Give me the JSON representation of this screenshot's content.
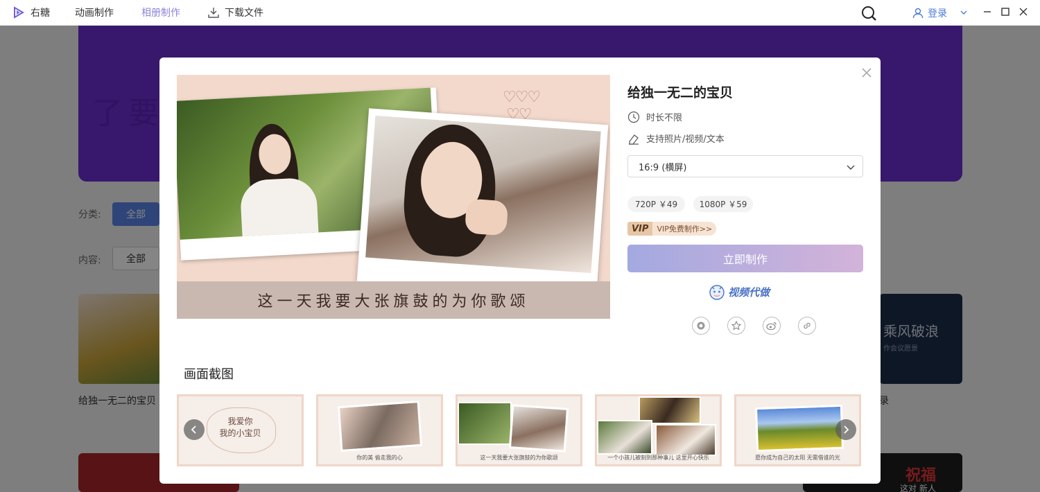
{
  "app": {
    "name": "右糖"
  },
  "nav": {
    "animation": "动画制作",
    "album": "相册制作",
    "download": "下载文件"
  },
  "header": {
    "login": "登录"
  },
  "background": {
    "banner_text": "了要一 夕日梦",
    "filter_category_label": "分类:",
    "filter_category_active": "全部",
    "filter_content_label": "内容:",
    "filter_content_active": "全部",
    "card_title_left": "给独一无二的宝贝",
    "card_right_text": "乘风破浪",
    "card_right_sub": "作会议愿景",
    "card_right_title_fragment": "录",
    "bottom_card_text": "祝福",
    "bottom_card_sub": "这对 新人"
  },
  "modal": {
    "title": "给独一无二的宝贝",
    "duration": "时长不限",
    "supports": "支持照片/视频/文本",
    "ratio_selected": "16:9 (横屏)",
    "prices": [
      {
        "label": "720P ￥49"
      },
      {
        "label": "1080P ￥59"
      }
    ],
    "vip_tag": "VIP",
    "vip_text": "VIP免费制作>>",
    "make_button": "立即制作",
    "proxy_label": "视频代做",
    "preview_caption": "这一天我要大张旗鼓的为你歌颂",
    "screenshots_title": "画面截图",
    "thumbs": [
      {
        "big": "我爱你\n我的小宝贝",
        "caption": ""
      },
      {
        "big": "",
        "caption": "你的美 偷走我的心"
      },
      {
        "big": "",
        "caption": "这一天我要大张旗鼓的为你歌颂"
      },
      {
        "big": "",
        "caption": "一个小孩儿被刻到那种事儿 这里开心快乐"
      },
      {
        "big": "",
        "caption": "愿你成为自己的太阳 无需借谁的光"
      }
    ]
  }
}
